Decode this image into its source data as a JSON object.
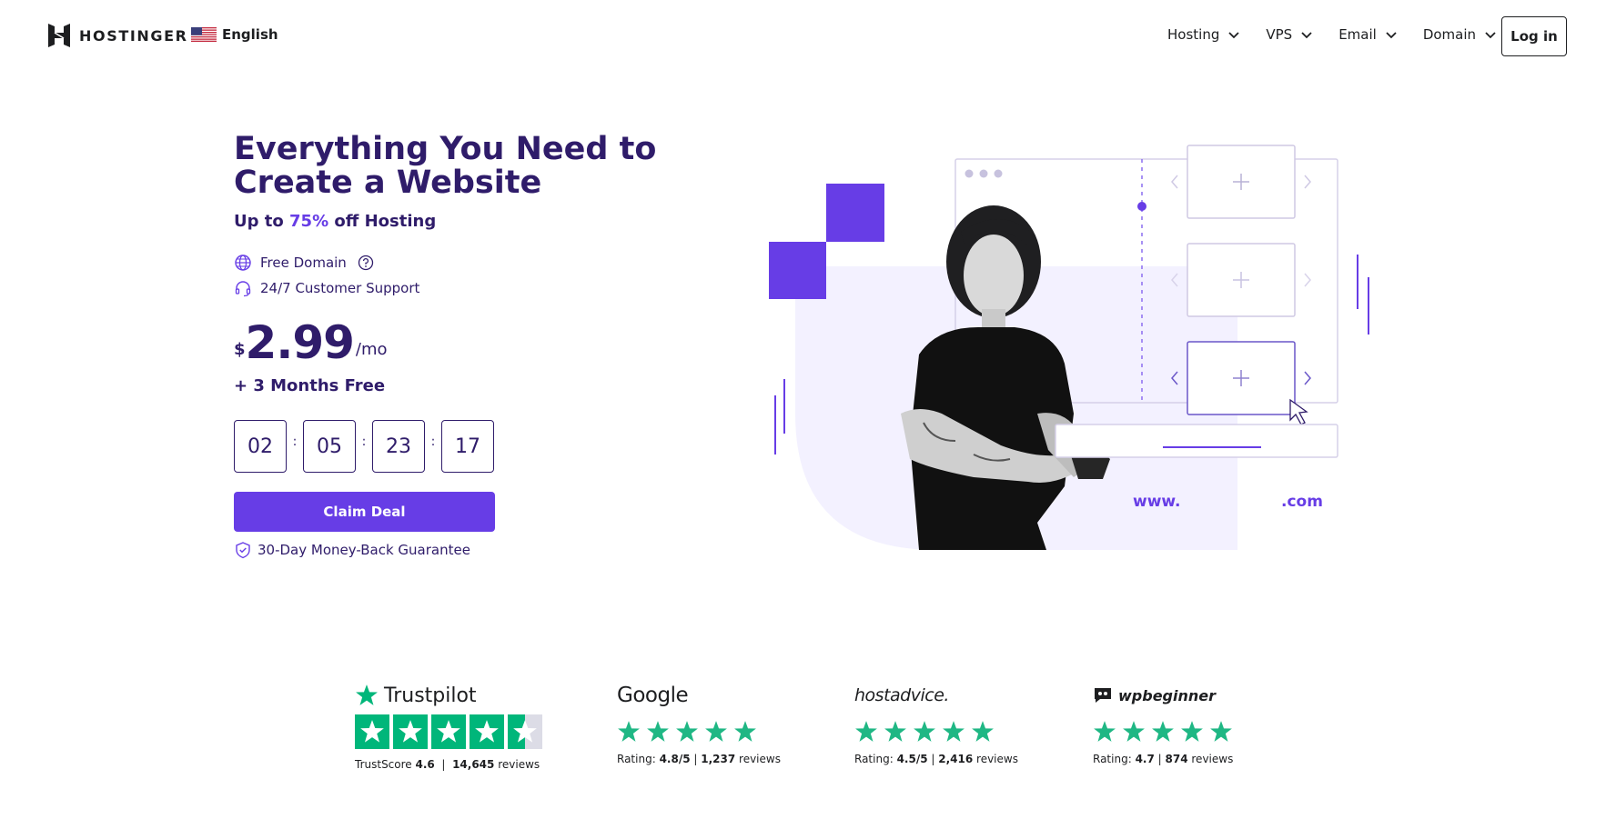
{
  "header": {
    "brand": "HOSTINGER",
    "language": "English",
    "nav": [
      "Hosting",
      "VPS",
      "Email",
      "Domain"
    ],
    "login_label": "Log in"
  },
  "hero": {
    "title": "Everything You Need to Create a Website",
    "subtitle_prefix": "Up to",
    "subtitle_accent": "75%",
    "subtitle_suffix": "off Hosting",
    "features": [
      "Free Domain",
      "24/7 Customer Support"
    ],
    "price_currency": "$",
    "price_amount": "2.99",
    "price_period": "/mo",
    "bonus": "+ 3 Months Free",
    "timer": [
      "02",
      "05",
      "23",
      "17"
    ],
    "timer_separator": ":",
    "cta_label": "Claim Deal",
    "guarantee": "30-Day Money-Back Guarantee",
    "domain_prefix": "www.",
    "domain_suffix": ".com"
  },
  "reviews": {
    "trustpilot": {
      "brand": "Trustpilot",
      "score_label": "TrustScore",
      "score": "4.6",
      "count": "14,645",
      "count_label": "reviews"
    },
    "google": {
      "brand": "Google",
      "rating_label": "Rating:",
      "rating": "4.8/5",
      "count": "1,237",
      "count_label": "reviews"
    },
    "hostadvice": {
      "brand": "hostadvice.",
      "rating_label": "Rating:",
      "rating": "4.5/5",
      "count": "2,416",
      "count_label": "reviews"
    },
    "wpbeginner": {
      "brand": "wpbeginner",
      "rating_label": "Rating:",
      "rating": "4.7",
      "count": "874",
      "count_label": "reviews"
    }
  },
  "colors": {
    "primary": "#673de6",
    "heading": "#2f1c6a",
    "star_green": "#00b67a",
    "review_star": "#1fb784"
  },
  "icons": [
    "hostinger-logo-icon",
    "us-flag-icon",
    "chevron-down-icon",
    "globe-icon",
    "help-circle-icon",
    "headset-icon",
    "shield-check-icon",
    "star-icon",
    "google-logo",
    "wpbeginner-logo-icon"
  ]
}
